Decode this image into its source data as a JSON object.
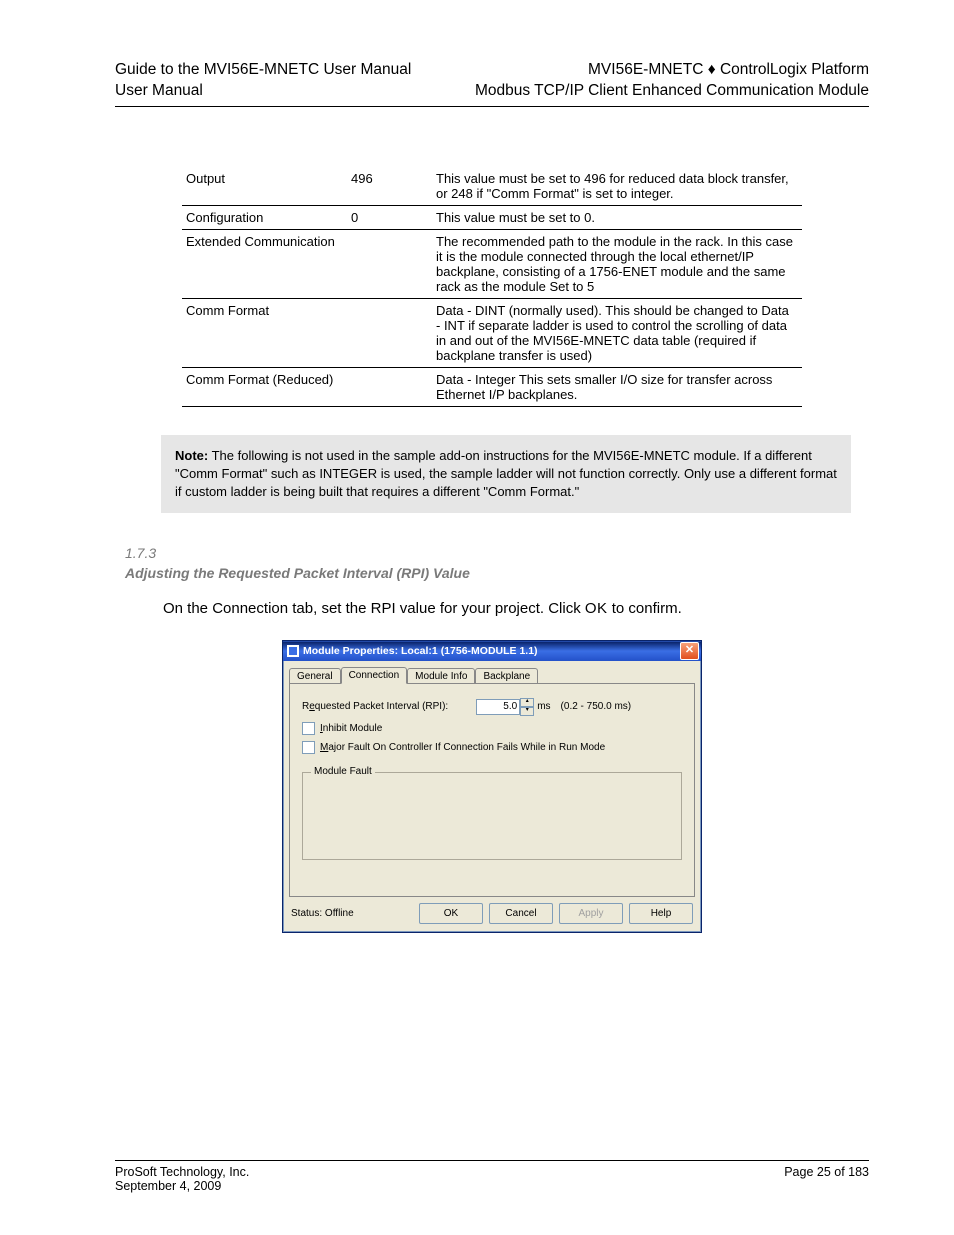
{
  "header": {
    "left_line1": "Guide to the MVI56E-MNETC User Manual",
    "left_line2": "User Manual",
    "right_line1a": "MVI56E-MNETC ",
    "right_line1b": " ControlLogix Platform",
    "right_line2": "Modbus TCP/IP Client Enhanced Communication Module"
  },
  "table": {
    "rows": [
      {
        "a": "Output",
        "b": "496",
        "c": "This value must be set to 496 for reduced data block transfer, or 248 if \"Comm Format\" is set to integer."
      },
      {
        "a": "Configuration",
        "b": "0",
        "c": "This value must be set to 0."
      },
      {
        "a": "Extended Communication",
        "b": "",
        "c": "The recommended path to the module in the rack. In this case it is the module connected through the local ethernet/IP backplane, consisting of a 1756-ENET module and the same rack as the module Set to 5"
      },
      {
        "a": "Comm Format",
        "b": "",
        "c": "Data - DINT (normally used). This should be changed to Data - INT if separate ladder is used to control the scrolling of data in and out of the MVI56E-MNETC data table (required if backplane transfer is used)"
      },
      {
        "a": "Comm Format (Reduced)",
        "b": "",
        "c": "Data - Integer This sets smaller I/O size for transfer across Ethernet I/P backplanes."
      }
    ]
  },
  "note": {
    "bold": "Note:",
    "text": " The following is not used in the sample add-on instructions for the MVI56E-MNETC module. If a different \"Comm Format\" such as INTEGER is used, the sample ladder will not function correctly. Only use a different format if custom ladder is being built that requires a different \"Comm Format.\""
  },
  "section": {
    "num": "1.7.3",
    "title": "Adjusting the Requested Packet Interval (RPI) Value"
  },
  "body": {
    "p1": "On the Connection tab, set the RPI value for your project. Click ",
    "p1b": "OK",
    "p1c": " to confirm."
  },
  "dialog": {
    "title": "Module Properties: Local:1 (1756-MODULE 1.1)",
    "tabs": {
      "general": "General",
      "connection": "Connection",
      "moduleinfo": "Module Info",
      "backplane": "Backplane"
    },
    "rpi_label_pre": "R",
    "rpi_label_u": "e",
    "rpi_label_post": "quested Packet Interval (RPI):",
    "rpi_value": "5.0",
    "rpi_unit": "ms",
    "rpi_range": "(0.2 - 750.0 ms)",
    "inhibit_u": "I",
    "inhibit_post": "nhibit Module",
    "major_u": "M",
    "major_post": "ajor Fault On Controller If Connection Fails While in Run Mode",
    "modulefault": "Module Fault",
    "status_label": "Status:",
    "status_value": "Offline",
    "ok": "OK",
    "cancel": "Cancel",
    "apply": "Apply",
    "help": "Help"
  },
  "footer": {
    "left_line1": "ProSoft Technology, Inc.",
    "left_line2": "September 4, 2009",
    "right": "Page 25 of 183"
  }
}
